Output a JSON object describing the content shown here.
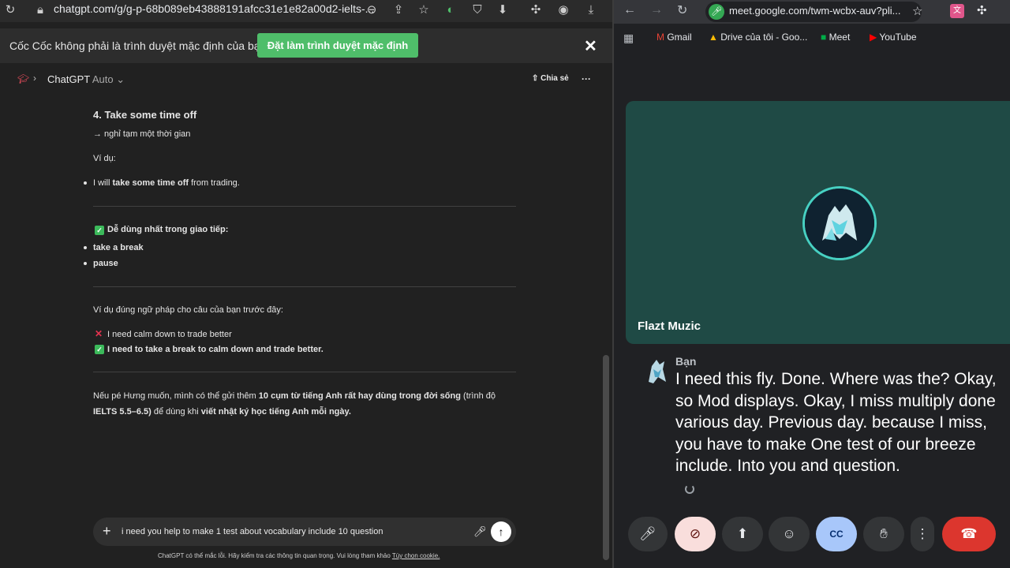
{
  "left_browser": {
    "url": "chatgpt.com/g/g-p-68b089eb43888191afcc31e1e82a00d2-ielts-...",
    "notice_text": "Cốc Cốc không phải là trình duyệt mặc định của bạn",
    "notice_button": "Đặt làm trình duyệt mặc định",
    "close_glyph": "✕"
  },
  "chatgpt": {
    "title": "ChatGPT",
    "model": "Auto",
    "share_label": "Chia sẻ",
    "more_glyph": "···"
  },
  "message": {
    "heading": "4. Take some time off",
    "arrow_line": "→ nghỉ tạm một thời gian",
    "example_label": "Ví dụ:",
    "example_prefix": "I will",
    "example_bold": "take some time off",
    "example_suffix": "from trading.",
    "easiest_label": "Dễ dùng nhất trong giao tiếp:",
    "easy_items": [
      "take a break",
      "pause"
    ],
    "grammar_label": "Ví dụ đúng ngữ pháp cho câu của bạn trước đây:",
    "wrong_sentence": "I need calm down to trade better",
    "right_sentence": "I need to take a break to calm down and trade better.",
    "closing_line1_a": "Nếu pé Hưng muốn, mình có thể gửi thêm",
    "closing_line1_b": "10 cụm từ tiếng Anh rất hay dùng trong đời sống",
    "closing_line1_c": "(trình độ",
    "closing_line2_a": "IELTS 5.5–6.5)",
    "closing_line2_b": "để dùng khi",
    "closing_line2_c": "viết nhật ký học tiếng Anh mỗi ngày."
  },
  "composer": {
    "value": "i need you help to make 1 test about vocabulary include 10 question",
    "footnote": "ChatGPT có thể mắc lỗi. Hãy kiểm tra các thông tin quan trọng. Vui lòng tham khảo",
    "footnote_link": "Tùy chọn cookie."
  },
  "right_browser": {
    "url": "meet.google.com/twm-wcbx-auv?pli...",
    "bookmarks": [
      "Gmail",
      "Drive của tôi - Goo...",
      "Meet",
      "YouTube"
    ]
  },
  "meet": {
    "participant_name": "Flazt Muzic",
    "caption_speaker": "Bạn",
    "caption_text": "I need this fly. Done. Where was the? Okay, so Mod displays. Okay, I miss multiply done various day. Previous day. because I miss, you have to make One test of our breeze include. Into you and question."
  }
}
